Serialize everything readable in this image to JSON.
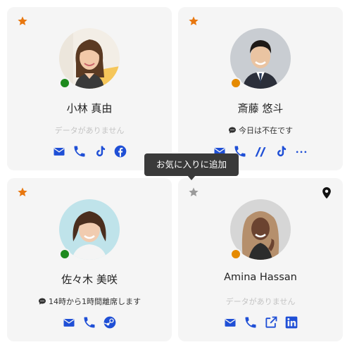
{
  "tooltip": {
    "text": "お気に入りに追加"
  },
  "colors": {
    "accent_blue": "#1f4fd6",
    "favorite": "#e8770f",
    "star_inactive": "#9a9a9a",
    "online": "#1e8a1e",
    "away": "#e58a00"
  },
  "cards": [
    {
      "name": "小林 真由",
      "favorite": true,
      "presence": "online",
      "detail": "データがありません",
      "icons": [
        "email-icon",
        "phone-icon",
        "tiktok-icon",
        "facebook-icon"
      ]
    },
    {
      "name": "斎藤 悠斗",
      "favorite": true,
      "presence": "away",
      "status_message": "今日は不在です",
      "icons": [
        "email-icon",
        "phone-icon",
        "slash-link-icon",
        "tiktok-icon",
        "more-icon"
      ]
    },
    {
      "name": "佐々木 美咲",
      "favorite": true,
      "presence": "online",
      "status_message": "14時から1時間離席します",
      "icons": [
        "email-icon",
        "phone-icon",
        "steam-icon"
      ]
    },
    {
      "name": "Amina Hassan",
      "favorite": false,
      "presence": "away",
      "detail": "データがありません",
      "has_location": true,
      "icons": [
        "email-icon",
        "phone-icon",
        "external-link-icon",
        "linkedin-icon"
      ]
    }
  ]
}
